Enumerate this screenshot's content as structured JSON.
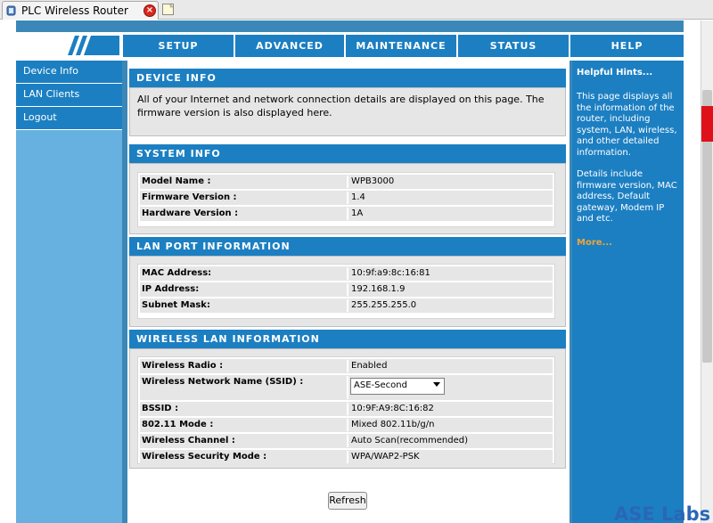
{
  "browser": {
    "tab_title": "PLC Wireless Router",
    "close_symbol": "×"
  },
  "nav": {
    "items": [
      "SETUP",
      "ADVANCED",
      "MAINTENANCE",
      "STATUS",
      "HELP"
    ]
  },
  "sidebar": {
    "items": [
      "Device Info",
      "LAN Clients",
      "Logout"
    ]
  },
  "device_info": {
    "title": "DEVICE INFO",
    "description": "All of your Internet and network connection details are displayed on this page. The firmware version is also displayed here."
  },
  "system_info": {
    "title": "SYSTEM INFO",
    "rows": [
      {
        "label": "Model Name :",
        "value": "WPB3000"
      },
      {
        "label": "Firmware Version :",
        "value": "1.4"
      },
      {
        "label": "Hardware Version :",
        "value": "1A"
      }
    ]
  },
  "lan_port": {
    "title": "LAN PORT INFORMATION",
    "rows": [
      {
        "label": "MAC Address:",
        "value": "10:9f:a9:8c:16:81"
      },
      {
        "label": "IP Address:",
        "value": "192.168.1.9"
      },
      {
        "label": "Subnet Mask:",
        "value": "255.255.255.0"
      }
    ]
  },
  "wireless": {
    "title": "WIRELESS LAN INFORMATION",
    "radio": {
      "label": "Wireless Radio :",
      "value": "Enabled"
    },
    "ssid": {
      "label": "Wireless Network Name (SSID) :",
      "value": "ASE-Second"
    },
    "rows": [
      {
        "label": "BSSID :",
        "value": "10:9F:A9:8C:16:82"
      },
      {
        "label": "802.11 Mode :",
        "value": "Mixed 802.11b/g/n"
      },
      {
        "label": "Wireless Channel :",
        "value": "Auto Scan(recommended)"
      },
      {
        "label": "Wireless Security Mode :",
        "value": "WPA/WAP2-PSK"
      }
    ]
  },
  "refresh_label": "Refresh",
  "hints": {
    "title": "Helpful Hints...",
    "p1": "This page displays all the information of the router, including system, LAN, wireless, and other detailed information.",
    "p2": "Details include firmware version, MAC address, Default gateway, Modem IP and etc.",
    "more": "More..."
  },
  "watermark": "ASE Labs",
  "colors": {
    "nav_blue": "#1c7fc2",
    "frame_blue": "#3b88b8",
    "sidebar_light": "#67b1e1",
    "more_orange": "#f0a33a"
  },
  "icons": [
    "globe-favicon-icon",
    "close-icon",
    "new-tab-icon",
    "logo-slashes-icon",
    "dropdown-arrow-icon"
  ]
}
